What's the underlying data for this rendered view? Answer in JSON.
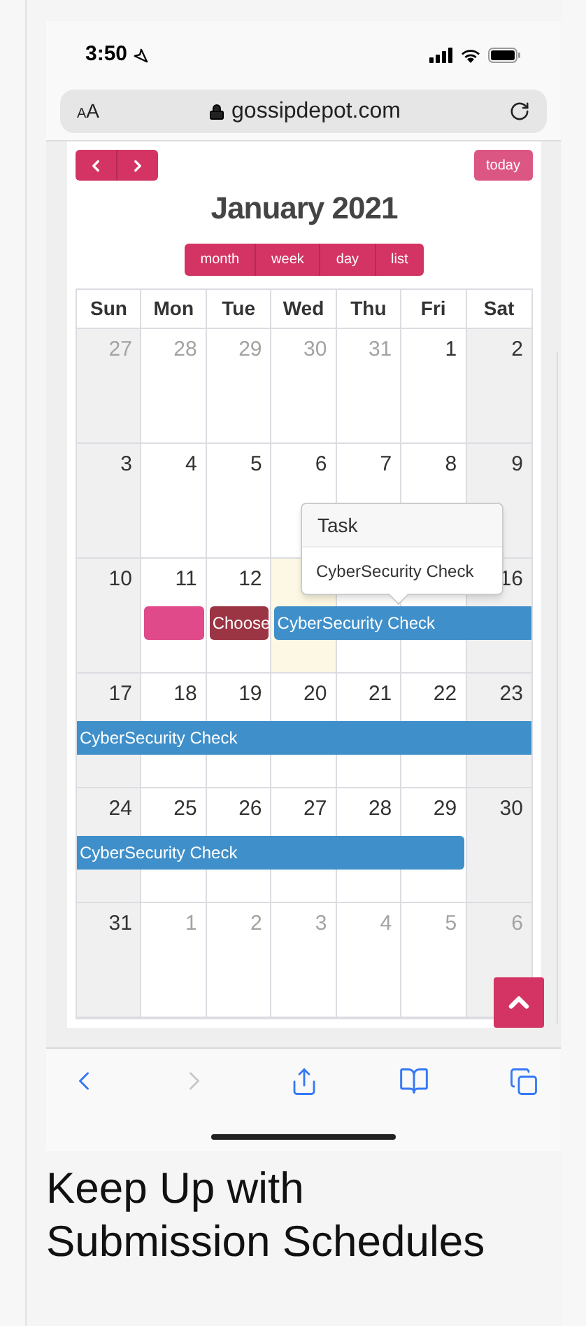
{
  "status_bar": {
    "time": "3:50"
  },
  "address_bar": {
    "text_size": "AA",
    "url": "gossipdepot.com"
  },
  "calendar": {
    "today_button": {
      "label": "today",
      "disabled": true
    },
    "title": "January 2021",
    "views": [
      "month",
      "week",
      "day",
      "list"
    ],
    "weekdays": [
      "Sun",
      "Mon",
      "Tue",
      "Wed",
      "Thu",
      "Fri",
      "Sat"
    ],
    "weeks": [
      {
        "days": [
          {
            "number": "27",
            "other_month": true,
            "today": false
          },
          {
            "number": "28",
            "other_month": true,
            "today": false
          },
          {
            "number": "29",
            "other_month": true,
            "today": false
          },
          {
            "number": "30",
            "other_month": true,
            "today": false
          },
          {
            "number": "31",
            "other_month": true,
            "today": false
          },
          {
            "number": "1",
            "other_month": false,
            "today": false
          },
          {
            "number": "2",
            "other_month": false,
            "today": false
          }
        ]
      },
      {
        "days": [
          {
            "number": "3",
            "other_month": false,
            "today": false
          },
          {
            "number": "4",
            "other_month": false,
            "today": false
          },
          {
            "number": "5",
            "other_month": false,
            "today": false
          },
          {
            "number": "6",
            "other_month": false,
            "today": false
          },
          {
            "number": "7",
            "other_month": false,
            "today": false
          },
          {
            "number": "8",
            "other_month": false,
            "today": false
          },
          {
            "number": "9",
            "other_month": false,
            "today": false
          }
        ]
      },
      {
        "days": [
          {
            "number": "10",
            "other_month": false,
            "today": false
          },
          {
            "number": "11",
            "other_month": false,
            "today": false
          },
          {
            "number": "12",
            "other_month": false,
            "today": false
          },
          {
            "today": true
          },
          {
            "today": false
          },
          {
            "today": false
          },
          {
            "number": "16",
            "other_month": false,
            "today": false
          }
        ],
        "events": [
          {
            "color": "#e0498a",
            "continues_before": false,
            "continues_after": false
          },
          {
            "title": "Choose",
            "color": "#9b3443",
            "continues_before": false,
            "continues_after": false
          },
          {
            "title": "CyberSecurity Check",
            "color": "#3f8fca",
            "continues_before": false,
            "continues_after": true
          }
        ]
      },
      {
        "days": [
          {
            "number": "17",
            "other_month": false,
            "today": false
          },
          {
            "number": "18",
            "other_month": false,
            "today": false
          },
          {
            "number": "19",
            "other_month": false,
            "today": false
          },
          {
            "number": "20",
            "other_month": false,
            "today": false
          },
          {
            "number": "21",
            "other_month": false,
            "today": false
          },
          {
            "number": "22",
            "other_month": false,
            "today": false
          },
          {
            "number": "23",
            "other_month": false,
            "today": false
          }
        ],
        "events": [
          {
            "title": "CyberSecurity Check",
            "color": "#3f8fca",
            "continues_before": true,
            "continues_after": true
          }
        ]
      },
      {
        "days": [
          {
            "number": "24",
            "other_month": false,
            "today": false
          },
          {
            "number": "25",
            "other_month": false,
            "today": false
          },
          {
            "number": "26",
            "other_month": false,
            "today": false
          },
          {
            "number": "27",
            "other_month": false,
            "today": false
          },
          {
            "number": "28",
            "other_month": false,
            "today": false
          },
          {
            "number": "29",
            "other_month": false,
            "today": false
          },
          {
            "number": "30",
            "other_month": false,
            "today": false
          }
        ],
        "events": [
          {
            "title": "CyberSecurity Check",
            "color": "#3f8fca",
            "continues_before": true,
            "continues_after": false
          }
        ]
      },
      {
        "days": [
          {
            "number": "31",
            "other_month": false,
            "today": false
          },
          {
            "number": "1",
            "other_month": true,
            "today": false
          },
          {
            "number": "2",
            "other_month": true,
            "today": false
          },
          {
            "number": "3",
            "other_month": true,
            "today": false
          },
          {
            "number": "4",
            "other_month": true,
            "today": false
          },
          {
            "number": "5",
            "other_month": true,
            "today": false
          },
          {
            "number": "6",
            "other_month": true,
            "today": false
          }
        ]
      }
    ],
    "popover": {
      "title": "Task",
      "body": "CyberSecurity Check"
    }
  },
  "toolbar": {
    "back_enabled": true,
    "forward_enabled": false
  },
  "caption": [
    "Keep Up with",
    "Submission Schedules"
  ]
}
